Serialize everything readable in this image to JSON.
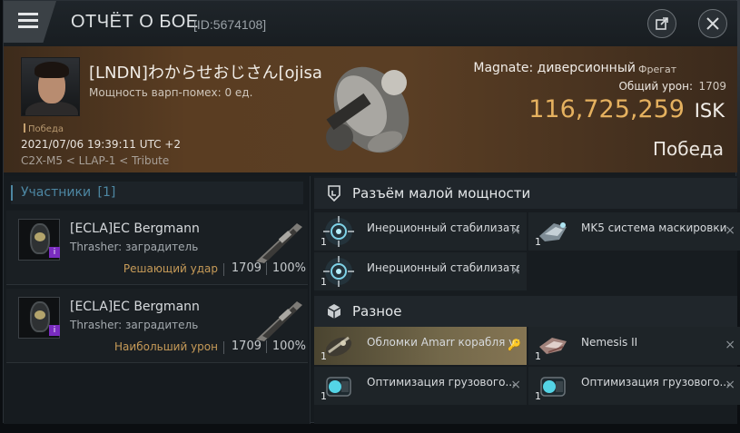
{
  "header": {
    "title": "ОТЧЁТ О БОЕ",
    "report_id": "[ID:5674108]",
    "menu_icon": "hamburger-menu-icon",
    "share_icon": "external-link-icon",
    "close_icon": "close-icon"
  },
  "victim": {
    "victory_tag": "Победа",
    "name": "[LNDN]わからせおじさん[ojisa",
    "warp_text": "Мощность варп-помех: 0 ед.",
    "datetime": "2021/07/06 19:39:11 UTC +2",
    "location": "C2X-M5 < LLAP-1 < Tribute",
    "ship_name": "Magnate: диверсионный",
    "ship_class": "Фрегат",
    "total_damage_label": "Общий урон:",
    "total_damage": "1709",
    "isk_value": "116,725,259",
    "isk_unit": "ISK",
    "result": "Победа"
  },
  "participants": {
    "tab_label": "Участники",
    "tab_count": "[1]",
    "attackers": [
      {
        "name": "[ECLA]EC Bergmann",
        "ship": "Thrasher: заградитель",
        "role": "Решающий удар",
        "damage": "1709",
        "percent": "100%",
        "badge": "i"
      },
      {
        "name": "[ECLA]EC Bergmann",
        "ship": "Thrasher: заградитель",
        "role": "Наибольший урон",
        "damage": "1709",
        "percent": "100%",
        "badge": "i"
      }
    ]
  },
  "fitting": {
    "section1_title": "Разъём малой мощности",
    "section2_title": "Разное",
    "low_slots": [
      {
        "name": "Инерционный стабилизато...",
        "qty": "1",
        "icon": "stabilizer-icon",
        "remove": "×"
      },
      {
        "name": "MK5 система маскировки",
        "qty": "1",
        "icon": "cloak-icon",
        "remove": "×"
      },
      {
        "name": "Инерционный стабилизато...",
        "qty": "1",
        "icon": "stabilizer-icon",
        "remove": "×"
      }
    ],
    "misc": [
      {
        "name": "Обломки Amarr корабля ус...",
        "qty": "1",
        "icon": "wreck-icon",
        "remove": "🔑"
      },
      {
        "name": "Nemesis II",
        "qty": "1",
        "icon": "drone-icon",
        "remove": "×"
      },
      {
        "name": "Оптимизация грузового...",
        "qty": "1",
        "icon": "rig-icon",
        "remove": "×"
      },
      {
        "name": "Оптимизация грузового...",
        "qty": "1",
        "icon": "rig-icon",
        "remove": "×"
      }
    ]
  }
}
